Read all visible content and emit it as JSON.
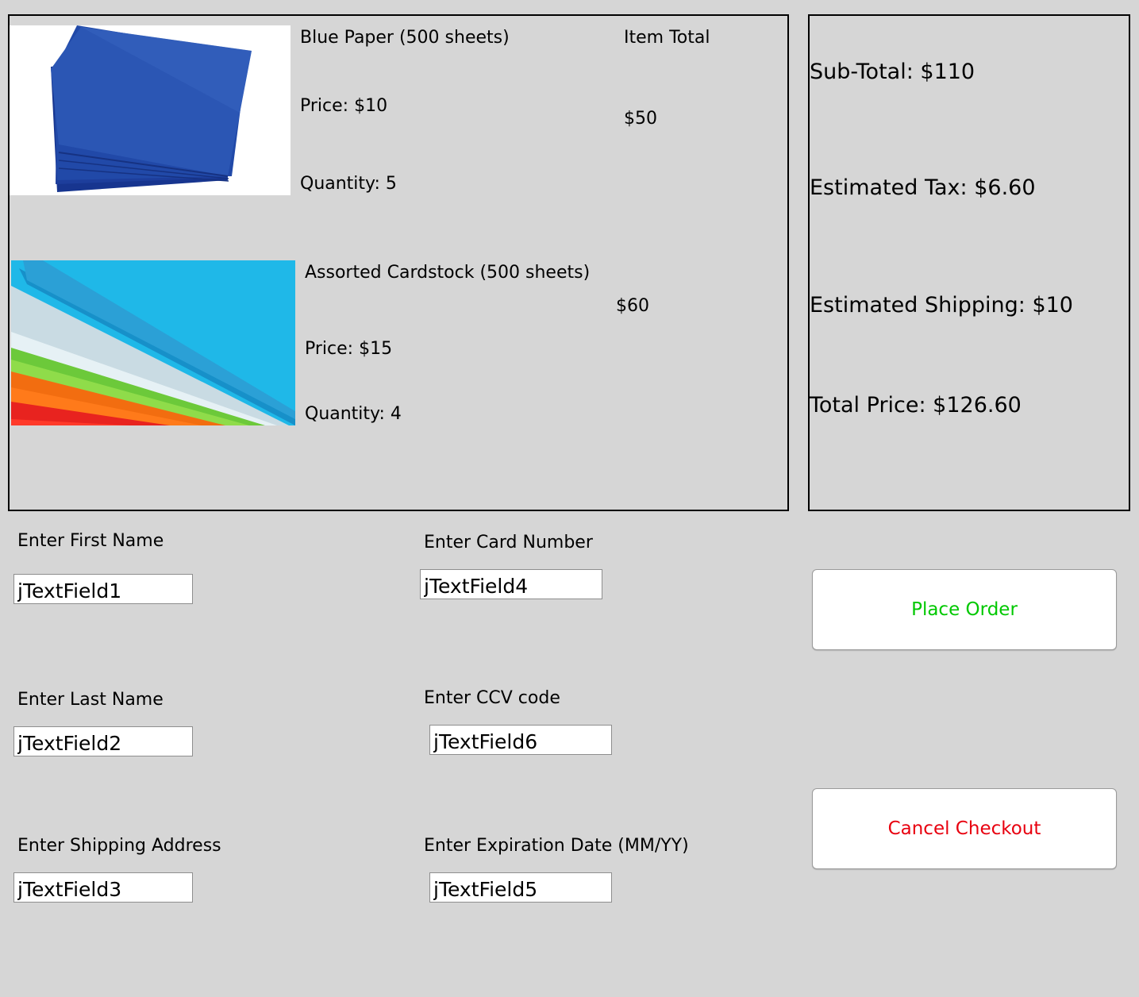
{
  "cart": {
    "item_total_header": "Item Total",
    "items": [
      {
        "name": "Blue Paper (500 sheets)",
        "price": "Price: $10",
        "quantity": "Quantity: 5",
        "total": "$50"
      },
      {
        "name": "Assorted Cardstock (500 sheets)",
        "price": "Price: $15",
        "quantity": "Quantity: 4",
        "total": "$60"
      }
    ]
  },
  "summary": {
    "subtotal": "Sub-Total: $110",
    "tax": "Estimated Tax: $6.60",
    "shipping": "Estimated Shipping: $10",
    "total": "Total Price: $126.60"
  },
  "form": {
    "first_name": {
      "label": "Enter First Name",
      "value": "jTextField1"
    },
    "last_name": {
      "label": "Enter Last Name",
      "value": "jTextField2"
    },
    "address": {
      "label": "Enter Shipping Address",
      "value": "jTextField3"
    },
    "card_number": {
      "label": "Enter Card Number",
      "value": "jTextField4"
    },
    "ccv": {
      "label": "Enter CCV code",
      "value": "jTextField6"
    },
    "expiration": {
      "label": "Enter Expiration Date (MM/YY)",
      "value": "jTextField5"
    }
  },
  "actions": {
    "place_order": "Place Order",
    "cancel": "Cancel Checkout"
  },
  "colors": {
    "place_order_text": "#00c800",
    "cancel_text": "#e8000f",
    "background": "#d6d6d6"
  }
}
